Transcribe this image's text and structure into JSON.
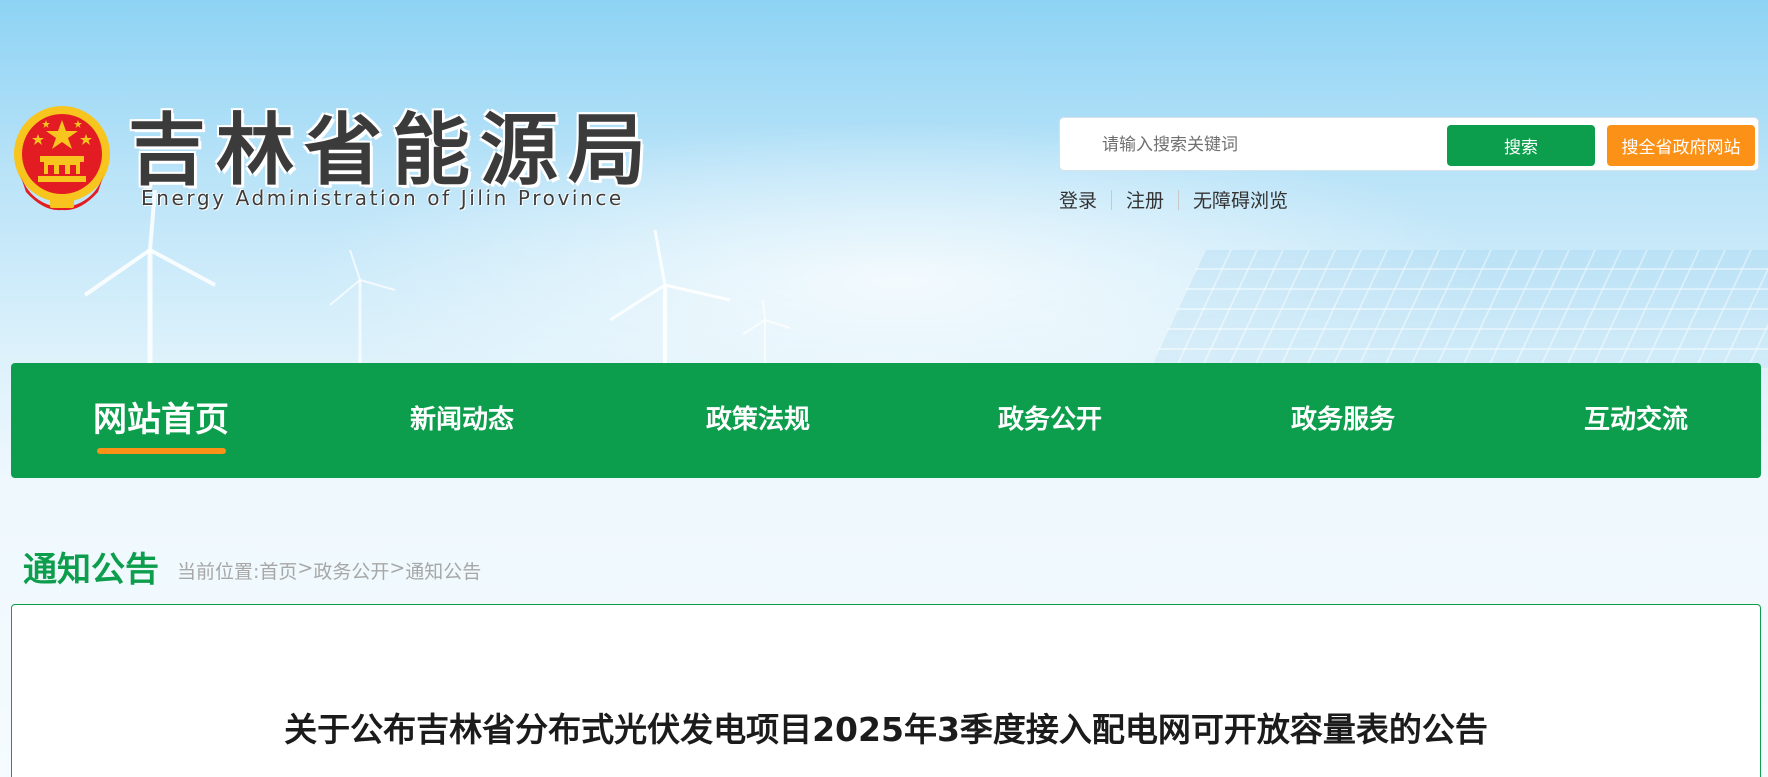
{
  "header": {
    "site_title": "吉林省能源局",
    "site_subtitle": "Energy Administration of Jilin Province"
  },
  "search": {
    "placeholder": "请输入搜索关键词",
    "search_label": "搜索",
    "search_province_label": "搜全省政府网站"
  },
  "user_links": {
    "login": "登录",
    "register": "注册",
    "accessibility": "无障碍浏览"
  },
  "nav": {
    "items": [
      {
        "label": "网站首页",
        "active": true
      },
      {
        "label": "新闻动态",
        "active": false
      },
      {
        "label": "政策法规",
        "active": false
      },
      {
        "label": "政务公开",
        "active": false
      },
      {
        "label": "政务服务",
        "active": false
      },
      {
        "label": "互动交流",
        "active": false
      }
    ]
  },
  "section": {
    "title": "通知公告",
    "breadcrumb_prefix": "当前位置:",
    "breadcrumb": [
      "首页",
      "政务公开",
      "通知公告"
    ],
    "breadcrumb_sep": ">"
  },
  "article": {
    "title": "关于公布吉林省分布式光伏发电项目2025年3季度接入配电网可开放容量表的公告"
  },
  "colors": {
    "brand_green": "#0c9e4c",
    "accent_orange": "#fb9116",
    "emblem_red": "#e31b23",
    "emblem_gold": "#f7c51e"
  }
}
